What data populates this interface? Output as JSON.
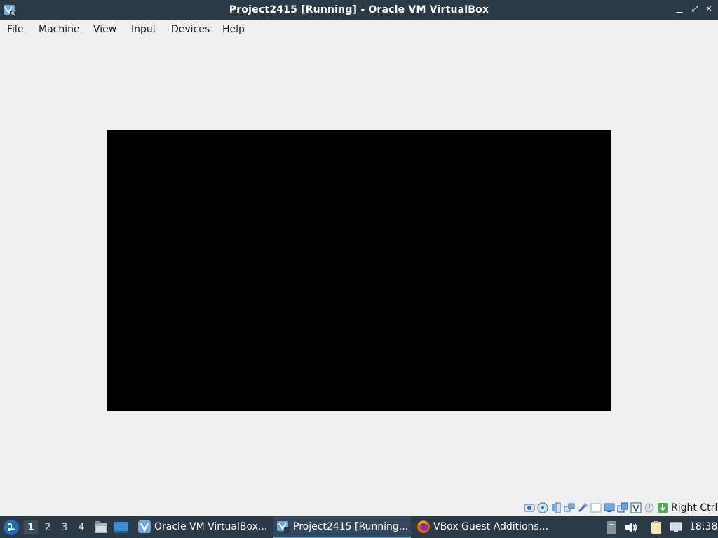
{
  "window": {
    "title": "Project2415 [Running] - Oracle VM VirtualBox",
    "min_glyph": "▁",
    "max_glyph": "⤢",
    "close_glyph": "✕"
  },
  "menu": {
    "items": [
      "File",
      "Machine",
      "View",
      "Input",
      "Devices",
      "Help"
    ]
  },
  "status_bar": {
    "icons": [
      "hard-disk-icon",
      "optical-drive-icon",
      "audio-icon",
      "network-icon",
      "usb-icon",
      "shared-folders-icon",
      "display-icon",
      "recording-icon",
      "vt-x-icon",
      "mouse-integration-icon",
      "keyboard-capture-icon"
    ],
    "host_key": "Right Ctrl"
  },
  "taskbar": {
    "workspaces": [
      "1",
      "2",
      "3",
      "4"
    ],
    "active_workspace": "1",
    "tasks": [
      {
        "label": "Oracle VM VirtualBox...",
        "icon": "virtualbox-icon"
      },
      {
        "label": "Project2415 [Running...",
        "icon": "vm-window-icon"
      },
      {
        "label": "VBox Guest Additions...",
        "icon": "firefox-icon"
      }
    ],
    "clock": "18:38"
  },
  "colors": {
    "titlebar": "#2b3a47",
    "taskbar": "#2b3a47",
    "background": "#efefef",
    "guest_screen": "#000000"
  }
}
